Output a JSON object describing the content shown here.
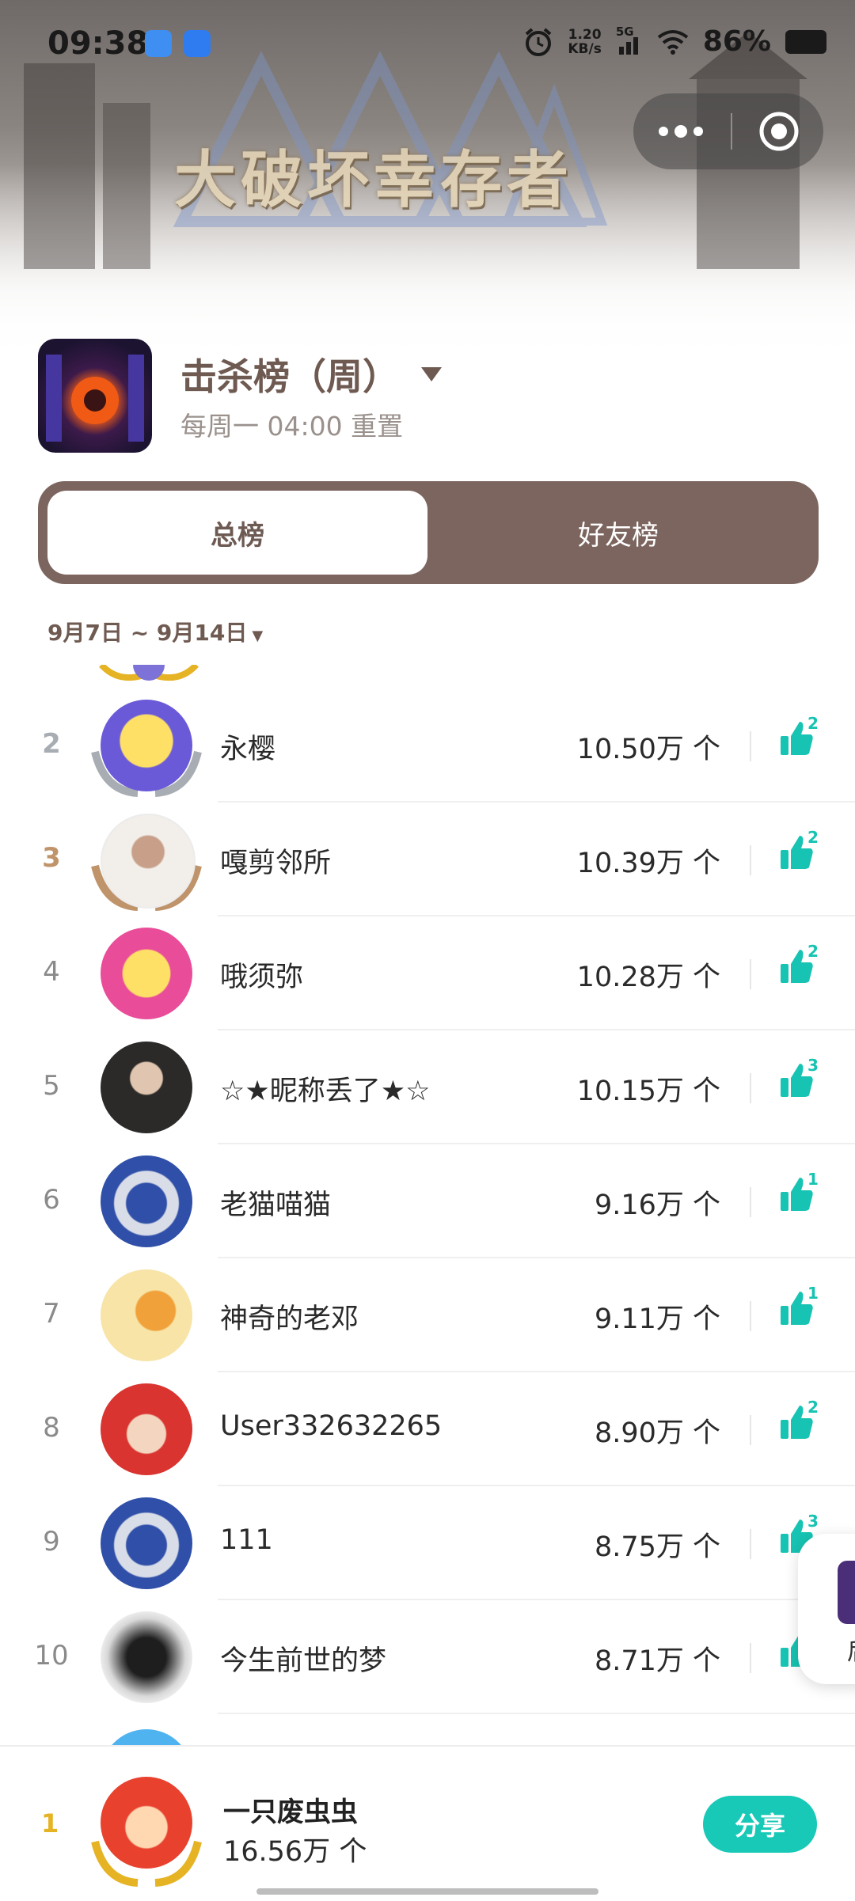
{
  "status_bar": {
    "time": "09:38",
    "net_speed_value": "1.20",
    "net_speed_unit": "KB/s",
    "signal": "5G",
    "battery": "86%"
  },
  "header": {
    "game_logo_text": "大破坏幸存者"
  },
  "board": {
    "title": "击杀榜（周）",
    "reset_note": "每周一 04:00 重置"
  },
  "tabs": [
    {
      "label": "总榜",
      "active": true
    },
    {
      "label": "好友榜",
      "active": false
    }
  ],
  "date_range": "9月7日 ~ 9月14日",
  "rows": [
    {
      "rank": "2",
      "name": "永樱",
      "score": "10.50万 个",
      "likes": "2",
      "avatar_color": "#6a5ad8"
    },
    {
      "rank": "3",
      "name": "嘎剪邻所",
      "score": "10.39万 个",
      "likes": "2",
      "avatar_color": "#f2eee9"
    },
    {
      "rank": "4",
      "name": "哦须弥",
      "score": "10.28万 个",
      "likes": "2",
      "avatar_color": "#e94d9a"
    },
    {
      "rank": "5",
      "name": "☆★昵称丢了★☆",
      "score": "10.15万 个",
      "likes": "3",
      "avatar_color": "#2c2a28"
    },
    {
      "rank": "6",
      "name": "老猫喵猫",
      "score": "9.16万 个",
      "likes": "1",
      "avatar_color": "#2f4fa8"
    },
    {
      "rank": "7",
      "name": "神奇的老邓",
      "score": "9.11万 个",
      "likes": "1",
      "avatar_color": "#f7e4a6"
    },
    {
      "rank": "8",
      "name": "User332632265",
      "score": "8.90万 个",
      "likes": "2",
      "avatar_color": "#d9342f"
    },
    {
      "rank": "9",
      "name": "111",
      "score": "8.75万 个",
      "likes": "3",
      "avatar_color": "#2f4fa8"
    },
    {
      "rank": "10",
      "name": "今生前世的梦",
      "score": "8.71万 个",
      "likes": "",
      "avatar_color": "#3a3a3a"
    }
  ],
  "me": {
    "rank": "1",
    "name": "一只废虫虫",
    "score": "16.56万 个",
    "share_label": "分享"
  },
  "floating_widget": {
    "partial_text": "后"
  },
  "colors": {
    "accent": "#17c9b6",
    "brown": "#7c655e",
    "gold": "#e6b325",
    "silver": "#a8adb3",
    "bronze": "#c0946a"
  }
}
